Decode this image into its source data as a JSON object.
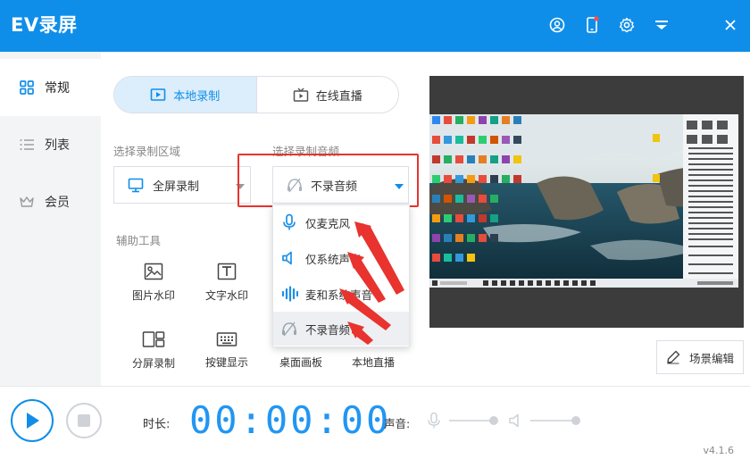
{
  "app": {
    "title": "EV录屏",
    "version": "v4.1.6"
  },
  "titlebar": {
    "icons": [
      "user-icon",
      "phone-icon",
      "gear-icon",
      "menu-icon",
      "close-icon"
    ]
  },
  "sidebar": {
    "items": [
      {
        "label": "常规",
        "icon": "grid-icon",
        "active": true
      },
      {
        "label": "列表",
        "icon": "list-icon",
        "active": false
      },
      {
        "label": "会员",
        "icon": "crown-icon",
        "active": false
      }
    ]
  },
  "mode_tabs": [
    {
      "label": "本地录制",
      "icon": "local-record-icon",
      "active": true
    },
    {
      "label": "在线直播",
      "icon": "tv-icon",
      "active": false
    }
  ],
  "record_area": {
    "label": "选择录制区域",
    "value": "全屏录制"
  },
  "record_audio": {
    "label": "选择录制音频",
    "value": "不录音频",
    "options": [
      {
        "label": "仅麦克风",
        "icon": "microphone-icon"
      },
      {
        "label": "仅系统声音",
        "icon": "speaker-icon"
      },
      {
        "label": "麦和系统声音",
        "icon": "soundwave-icon"
      },
      {
        "label": "不录音频",
        "icon": "no-audio-icon",
        "selected": true
      }
    ]
  },
  "tools": {
    "label": "辅助工具",
    "items": [
      {
        "label": "图片水印",
        "icon": "image-icon"
      },
      {
        "label": "文字水印",
        "icon": "text-icon"
      },
      {
        "label": "分屏录制",
        "icon": "split-screen-icon"
      },
      {
        "label": "按键显示",
        "icon": "keyboard-icon"
      },
      {
        "label": "桌面画板",
        "icon": "board-icon"
      },
      {
        "label": "本地直播",
        "icon": "live-icon"
      }
    ]
  },
  "scene_button": {
    "label": "场景编辑",
    "icon": "edit-icon"
  },
  "bottom": {
    "duration_label": "时长:",
    "timer": "00:00:00",
    "volume_label": "声音:"
  },
  "colors": {
    "accent": "#0f8ee9",
    "annotation_red": "#e8332f"
  }
}
